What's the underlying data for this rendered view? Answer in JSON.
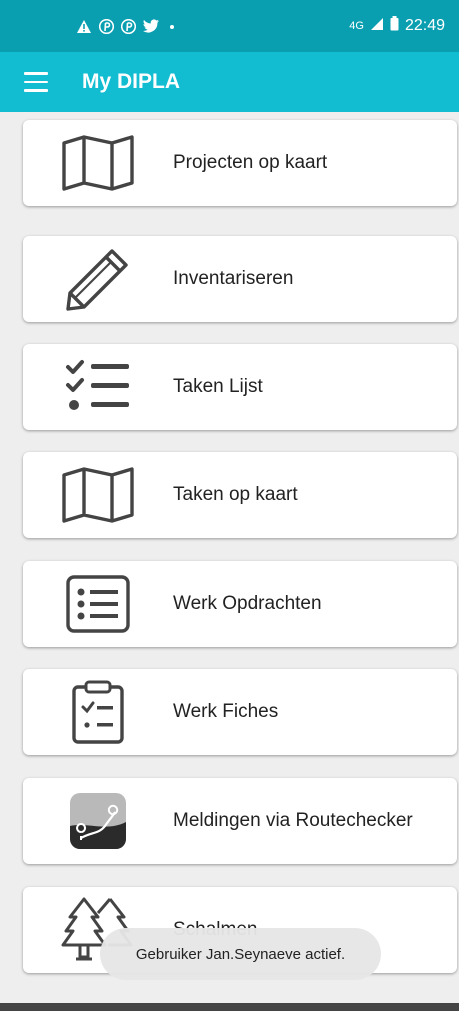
{
  "status_bar": {
    "left_icons": [
      "warning-icon",
      "pinterest-icon",
      "pinterest-icon",
      "twitter-icon",
      "dot-icon"
    ],
    "network": "4G",
    "time": "22:49"
  },
  "app_bar": {
    "title": "My DIPLA",
    "menu_icon": "hamburger-menu-icon"
  },
  "menu_items": [
    {
      "label": "Projecten op kaart",
      "icon": "map-icon"
    },
    {
      "label": "Inventariseren",
      "icon": "pencil-icon"
    },
    {
      "label": "Taken Lijst",
      "icon": "checklist-icon"
    },
    {
      "label": "Taken op kaart",
      "icon": "map-icon"
    },
    {
      "label": "Werk Opdrachten",
      "icon": "list-box-icon"
    },
    {
      "label": "Werk Fiches",
      "icon": "clipboard-icon"
    },
    {
      "label": "Meldingen via Routechecker",
      "icon": "routechecker-icon"
    },
    {
      "label": "Schalmen",
      "icon": "trees-icon"
    }
  ],
  "toast": {
    "text": "Gebruiker Jan.Seynaeve actief."
  },
  "colors": {
    "status_bar": "#0a9fb0",
    "app_bar": "#12bdd1",
    "icon": "#444444"
  }
}
